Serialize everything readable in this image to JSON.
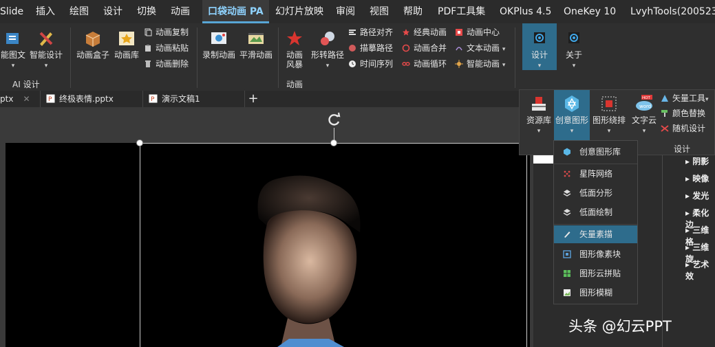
{
  "menubar": [
    "Slide",
    "插入",
    "绘图",
    "设计",
    "切换",
    "动画",
    "口袋动画 PA",
    "幻灯片放映",
    "审阅",
    "视图",
    "帮助",
    "PDF工具集",
    "OKPlus 4.5",
    "OneKey 10",
    "LvyhTools(200523)"
  ],
  "ribbon": {
    "ai_group": {
      "btn1": "能图文",
      "btn2": "智能设计",
      "label": "AI 设计"
    },
    "anim_group": {
      "box": "动画盒子",
      "lib": "动画库",
      "copy": "动画复制",
      "paste": "动画粘贴",
      "delete": "动画删除",
      "record": "录制动画",
      "smooth": "平滑动画",
      "storm1": "动画",
      "storm2": "风暴",
      "shape_path": "形转路径",
      "path_align": "路径对齐",
      "trace_path": "描摹路径",
      "timeline": "时间序列",
      "classic": "经典动画",
      "merge": "动画合并",
      "loop": "动画循环",
      "center": "动画中心",
      "text_anim": "文本动画",
      "smart": "智能动画",
      "label": "动画"
    },
    "design_btn": "设计",
    "about_btn": "关于"
  },
  "tabs": {
    "partial": "ptx",
    "tab1": "终极表情.pptx",
    "tab2": "演示文稿1",
    "add": "+"
  },
  "design_panel": {
    "resources": "资源库",
    "creative": "创意图形",
    "arrange": "图形绕排",
    "wordcloud": "文字云",
    "hot": "HOT",
    "word": "word",
    "vector_tools": "矢量工具",
    "color_replace": "颜色替换",
    "random": "随机设计",
    "label": "设计"
  },
  "dropdown": [
    "创意图形库",
    "星阵网络",
    "低面分形",
    "低面绘制",
    "矢量素描",
    "图形像素块",
    "图形云拼贴",
    "图形模糊"
  ],
  "dropdown_selected": 4,
  "right_pane": [
    "阴影",
    "映像",
    "发光",
    "柔化边",
    "三维格",
    "三维旋",
    "艺术效"
  ],
  "watermark": "头条 @幻云PPT",
  "colors": {
    "accent": "#58a6d6",
    "selected": "#2e6c8c",
    "slide": "#000000"
  }
}
